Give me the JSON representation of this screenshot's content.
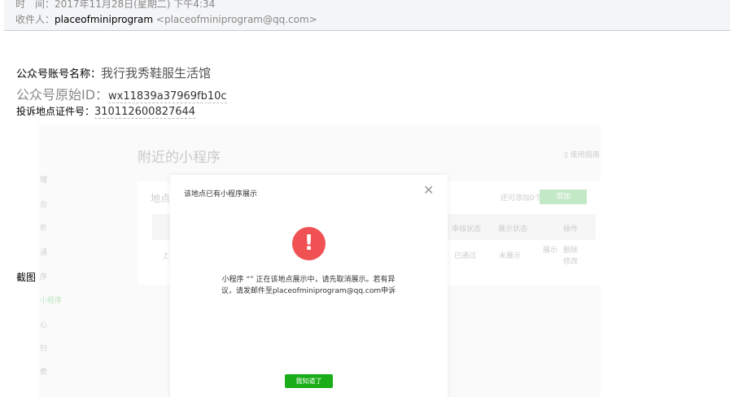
{
  "header": {
    "time_label": "时　间：",
    "time_value": "2017年11月28日(星期二) 下午4:34",
    "to_label": "收件人：",
    "to_name": "placeofminiprogram",
    "to_email": "<placeofminiprogram@qq.com>"
  },
  "info": {
    "account_label": "公众号账号名称：",
    "account_value": "我行我秀鞋服生活馆",
    "id_label": "公众号原始ID：",
    "id_value": "wx11839a37969fb10c",
    "cert_label": "投诉地点证件号：",
    "cert_value": "310112600827644"
  },
  "caption": "截图",
  "screenshot": {
    "sidebar": [
      "理",
      "台",
      "析",
      "通",
      "序",
      "小程序",
      "心",
      "扫",
      "费"
    ],
    "page_title": "附近的小程序",
    "guide": "使用指南",
    "card_title": "地点",
    "remaining": "还可添加0个",
    "add_button": "添加",
    "columns": [
      "审核状态",
      "展示状态",
      "操作"
    ],
    "row": {
      "first": "上",
      "audit": "已通过",
      "display": "未展示",
      "action_show": "展示",
      "action_delete": "删除",
      "action_edit": "修改"
    },
    "modal": {
      "title": "该地点已有小程序展示",
      "message": "小程序 “” 正在该地点展示中，请先取消展示。若有异议，请发邮件至placeofminiprogram@qq.com申诉",
      "ok_button": "我知道了"
    }
  }
}
